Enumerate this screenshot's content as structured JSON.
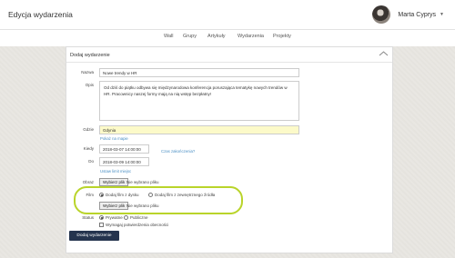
{
  "header": {
    "app_title": "Edycja wydarzenia",
    "user_name": "Marta Cyprys",
    "user_caret_icon": "caret-down-icon"
  },
  "nav": {
    "items": [
      "Wall",
      "Grupy",
      "Artykuły",
      "Wydarzenia",
      "Projekty"
    ]
  },
  "panel": {
    "title": "Dodaj wydarzenie",
    "toggle_icon": "chevron-up-icon"
  },
  "form": {
    "name_label": "Nazwa",
    "name_value": "Nowe trendy w HR",
    "description_label": "Opis",
    "description_value": "Od dziś do piątku odbywa się międzynarodowa konferencja poruszająca tematykę nowych trendów w HR. Pracownicy naszej formy mają na nią wstęp bezpłatny!",
    "location_label": "Gdzie",
    "location_value": "Gdynia",
    "show_on_map_link": "Pokaż na mapie",
    "start_label": "Kiedy",
    "start_value": "2018-03-07 14:00:00",
    "end_question_link": "Czas zakończenia?",
    "end_label": "Do",
    "end_value": "2018-03-09 14:00:00",
    "limit_link": "Ustaw limit miejsc",
    "image_label": "Obraz",
    "file_button": "Wybierz plik",
    "no_file_text": "Nie wybrano pliku",
    "film_label": "Film",
    "film_option_disk": "Dodaj film z dysku",
    "film_option_external": "Dodaj film z zewnętrznego źródła",
    "film_file_button": "Wybierz plik",
    "film_no_file_text": "Nie wybrano pliku",
    "status_label": "Status",
    "status_private": "Prywatne",
    "status_public": "Publiczne",
    "require_confirmation": "Wymagaj potwierdzenia obecności",
    "submit_button": "Dodaj wydarzenie"
  },
  "colors": {
    "highlight_oval": "#b9d42a",
    "submit_bg": "#25344e",
    "link": "#4a8fc4",
    "location_bg": "#fcfac9"
  }
}
